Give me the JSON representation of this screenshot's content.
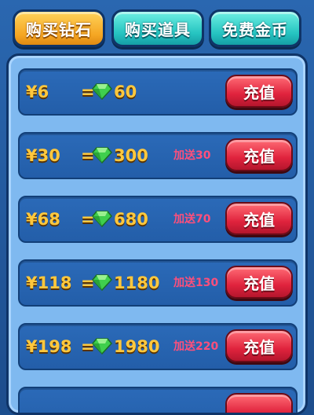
{
  "tabs": [
    {
      "label": "购买钻石",
      "active": true
    },
    {
      "label": "购买道具",
      "active": false
    },
    {
      "label": "免费金币",
      "active": false
    }
  ],
  "currency_symbol": "¥",
  "equals": "=",
  "items": [
    {
      "price": "¥6",
      "amount": "60",
      "bonus": "",
      "button": "充值"
    },
    {
      "price": "¥30",
      "amount": "300",
      "bonus": "加送30",
      "button": "充值"
    },
    {
      "price": "¥68",
      "amount": "680",
      "bonus": "加送70",
      "button": "充值"
    },
    {
      "price": "¥118",
      "amount": "1180",
      "bonus": "加送130",
      "button": "充值"
    },
    {
      "price": "¥198",
      "amount": "1980",
      "bonus": "加送220",
      "button": "充值"
    }
  ],
  "colors": {
    "accent_gold": "#ffc83d",
    "bonus_pink": "#ff4f7b",
    "button_red": "#e0233d",
    "tab_active": "#f5a623",
    "tab_inactive": "#26c4c1"
  },
  "icons": {
    "gem": "green-gem-icon"
  }
}
